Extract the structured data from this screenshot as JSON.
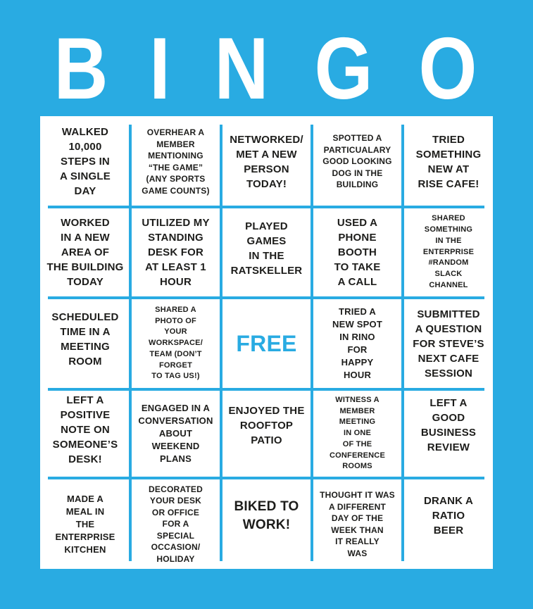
{
  "title": {
    "letters": [
      "B",
      "I",
      "N",
      "G",
      "O"
    ]
  },
  "colors": {
    "background": "#29abe2",
    "card": "#ffffff",
    "text": "#1d1d1b",
    "free_text": "#29abe2"
  },
  "board": {
    "rows": [
      [
        "WALKED\n10,000\nSTEPS IN\nA SINGLE\nDAY",
        "OVERHEAR A\nMEMBER\nMENTIONING\n“THE GAME”\n(ANY SPORTS\nGAME COUNTS)",
        "NETWORKED/\nMET A NEW\nPERSON\nTODAY!",
        "SPOTTED A\nPARTICUALARY\nGOOD LOOKING\nDOG IN THE\nBUILDING",
        "TRIED\nSOMETHING\nNEW AT\nRISE CAFE!"
      ],
      [
        "WORKED\nIN A NEW\nAREA OF\nTHE BUILDING\nTODAY",
        "UTILIZED MY\nSTANDING\nDESK FOR\nAT LEAST 1\nHOUR",
        "PLAYED\nGAMES\nIN THE\nRATSKELLER",
        "USED A\nPHONE\nBOOTH\nTO TAKE\nA CALL",
        "SHARED\nSOMETHING\nIN THE\nENTERPRISE\n#RANDOM\nSLACK\nCHANNEL"
      ],
      [
        "SCHEDULED\nTIME IN A\nMEETING\nROOM",
        "SHARED A\nPHOTO OF\nYOUR\nWORKSPACE/\nTEAM (DON’T\nFORGET\nTO TAG US!)",
        "FREE",
        "TRIED A\nNEW SPOT\nIN RINO\nFOR\nHAPPY\nHOUR",
        "SUBMITTED\nA QUESTION\nFOR STEVE’S\nNEXT CAFE\nSESSION"
      ],
      [
        "LEFT A\nPOSITIVE\nNOTE ON\nSOMEONE’S\nDESK!",
        "ENGAGED IN A\nCONVERSATION\nABOUT\nWEEKEND\nPLANS",
        "ENJOYED THE\nROOFTOP\nPATIO",
        "WITNESS A\nMEMBER\nMEETING\nIN ONE\nOF THE\nCONFERENCE\nROOMS",
        "LEFT A\nGOOD\nBUSINESS\nREVIEW"
      ],
      [
        "MADE A\nMEAL IN\nTHE\nENTERPRISE\nKITCHEN",
        "DECORATED\nYOUR DESK\nOR OFFICE\nFOR A\nSPECIAL\nOCCASION/\nHOLIDAY",
        "BIKED TO\nWORK!",
        "THOUGHT IT WAS\nA DIFFERENT\nDAY OF THE\nWEEK THAN\nIT REALLY\nWAS",
        "DRANK A\nRATIO\nBEER"
      ]
    ]
  }
}
